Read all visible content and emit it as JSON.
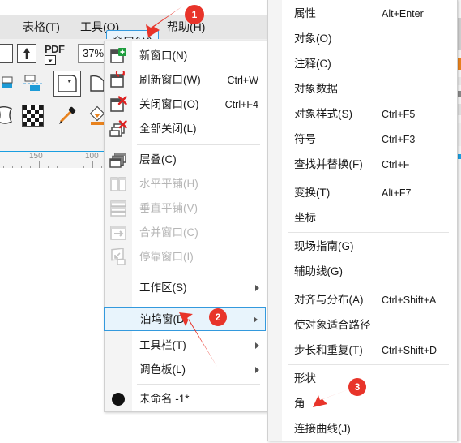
{
  "app": {
    "menubar": {
      "items": [
        {
          "id": "table",
          "label": "表格",
          "mnemonic": "T",
          "full": "表格(T)"
        },
        {
          "id": "tools",
          "label": "工具",
          "mnemonic": "O",
          "full": "工具(O)"
        },
        {
          "id": "window",
          "label": "窗口",
          "mnemonic": "W",
          "full": "窗口(W)",
          "selected": true
        },
        {
          "id": "help",
          "label": "帮助",
          "mnemonic": "H",
          "full": "帮助(H)"
        }
      ]
    },
    "toolbar": {
      "pdf_label": "PDF",
      "zoom_value": "37%"
    },
    "ruler": {
      "labels": [
        "150",
        "100"
      ]
    }
  },
  "window_menu": {
    "items": [
      {
        "id": "new-window",
        "label": "新窗口",
        "mnemonic": "N",
        "full": "新窗口(N)",
        "accel": "",
        "icon": "window-new-icon",
        "disabled": false,
        "submenu": false
      },
      {
        "id": "refresh-window",
        "label": "刷新窗口",
        "mnemonic": "W",
        "full": "刷新窗口(W)",
        "accel": "Ctrl+W",
        "icon": "window-refresh-icon",
        "disabled": false,
        "submenu": false
      },
      {
        "id": "close-window",
        "label": "关闭窗口",
        "mnemonic": "O",
        "full": "关闭窗口(O)",
        "accel": "Ctrl+F4",
        "icon": "window-close-icon",
        "disabled": false,
        "submenu": false
      },
      {
        "id": "close-all",
        "label": "全部关闭",
        "mnemonic": "L",
        "full": "全部关闭(L)",
        "accel": "",
        "icon": "window-close-all-icon",
        "disabled": false,
        "submenu": false
      },
      {
        "id": "cascade",
        "label": "层叠",
        "mnemonic": "C",
        "full": "层叠(C)",
        "accel": "",
        "icon": "cascade-icon",
        "disabled": false,
        "submenu": false
      },
      {
        "id": "tile-horizontal",
        "label": "水平平铺",
        "mnemonic": "H",
        "full": "水平平铺(H)",
        "accel": "",
        "icon": "tile-horizontal-icon",
        "disabled": true,
        "submenu": false
      },
      {
        "id": "tile-vertical",
        "label": "垂直平铺",
        "mnemonic": "V",
        "full": "垂直平铺(V)",
        "accel": "",
        "icon": "tile-vertical-icon",
        "disabled": true,
        "submenu": false
      },
      {
        "id": "merge-window",
        "label": "合并窗口",
        "mnemonic": "C",
        "full": "合并窗口(C)",
        "accel": "",
        "icon": "merge-window-icon",
        "disabled": true,
        "submenu": false
      },
      {
        "id": "dock-window",
        "label": "停靠窗口",
        "mnemonic": "I",
        "full": "停靠窗口(I)",
        "accel": "",
        "icon": "dock-window-icon",
        "disabled": true,
        "submenu": false
      },
      {
        "id": "workspace",
        "label": "工作区",
        "mnemonic": "S",
        "full": "工作区(S)",
        "accel": "",
        "icon": "",
        "disabled": false,
        "submenu": true
      },
      {
        "id": "docker",
        "label": "泊坞窗",
        "mnemonic": "D",
        "full": "泊坞窗(D)",
        "accel": "",
        "icon": "",
        "disabled": false,
        "submenu": true,
        "highlighted": true
      },
      {
        "id": "toolbar",
        "label": "工具栏",
        "mnemonic": "T",
        "full": "工具栏(T)",
        "accel": "",
        "icon": "",
        "disabled": false,
        "submenu": true
      },
      {
        "id": "palette",
        "label": "调色板",
        "mnemonic": "L",
        "full": "调色板(L)",
        "accel": "",
        "icon": "",
        "disabled": false,
        "submenu": true
      },
      {
        "id": "document-untitled",
        "label": "未命名 -1*",
        "mnemonic": "",
        "full": "未命名 -1*",
        "accel": "",
        "icon": "document-dot-icon",
        "disabled": false,
        "submenu": false
      }
    ]
  },
  "docker_submenu": {
    "items": [
      {
        "id": "properties",
        "label": "属性",
        "full": "属性",
        "accel": "Alt+Enter"
      },
      {
        "id": "object",
        "label": "对象",
        "mnemonic": "O",
        "full": "对象(O)",
        "accel": ""
      },
      {
        "id": "annotation",
        "label": "注释",
        "mnemonic": "C",
        "full": "注释(C)",
        "accel": ""
      },
      {
        "id": "object-data",
        "label": "对象数据",
        "full": "对象数据",
        "accel": ""
      },
      {
        "id": "object-styles",
        "label": "对象样式",
        "mnemonic": "S",
        "full": "对象样式(S)",
        "accel": "Ctrl+F5"
      },
      {
        "id": "symbol",
        "label": "符号",
        "full": "符号",
        "accel": "Ctrl+F3"
      },
      {
        "id": "find-replace",
        "label": "查找并替换",
        "mnemonic": "F",
        "full": "查找并替换(F)",
        "accel": "Ctrl+F"
      },
      {
        "id": "transform",
        "label": "变换",
        "mnemonic": "T",
        "full": "变换(T)",
        "accel": "Alt+F7"
      },
      {
        "id": "coordinates",
        "label": "坐标",
        "full": "坐标",
        "accel": ""
      },
      {
        "id": "live-guide",
        "label": "现场指南",
        "mnemonic": "G",
        "full": "现场指南(G)",
        "accel": ""
      },
      {
        "id": "guidelines",
        "label": "辅助线",
        "mnemonic": "G",
        "full": "辅助线(G)",
        "accel": ""
      },
      {
        "id": "align-distribute",
        "label": "对齐与分布",
        "mnemonic": "A",
        "full": "对齐与分布(A)",
        "accel": "Ctrl+Shift+A"
      },
      {
        "id": "fit-object-to-path",
        "label": "使对象适合路径",
        "full": "使对象适合路径",
        "accel": ""
      },
      {
        "id": "step-repeat",
        "label": "步长和重复",
        "mnemonic": "T",
        "full": "步长和重复(T)",
        "accel": "Ctrl+Shift+D"
      },
      {
        "id": "shape",
        "label": "形状",
        "full": "形状",
        "accel": ""
      },
      {
        "id": "corner",
        "label": "角",
        "full": "角",
        "accel": ""
      },
      {
        "id": "connect-curve",
        "label": "连接曲线",
        "mnemonic": "J",
        "full": "连接曲线(J)",
        "accel": ""
      }
    ]
  },
  "annotations": {
    "accent_color": "#e8342a",
    "badges": [
      {
        "id": "step-1",
        "label": "1"
      },
      {
        "id": "step-2",
        "label": "2"
      },
      {
        "id": "step-3",
        "label": "3"
      }
    ]
  }
}
